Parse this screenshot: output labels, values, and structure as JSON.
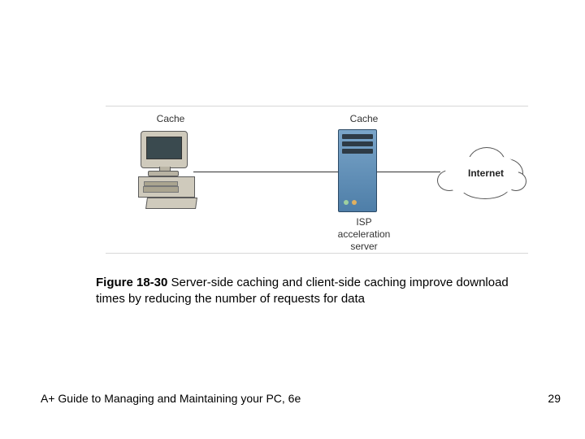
{
  "diagram": {
    "cache1_label": "Cache",
    "cache2_label": "Cache",
    "isp_label": "ISP\nacceleration\nserver",
    "internet_label": "Internet"
  },
  "caption": {
    "figure_number": "Figure 18-30",
    "text": " Server-side caching and client-side caching improve download times by reducing the number of requests for data"
  },
  "footer": {
    "left": "A+ Guide to Managing and Maintaining your PC, 6e",
    "page": "29"
  }
}
